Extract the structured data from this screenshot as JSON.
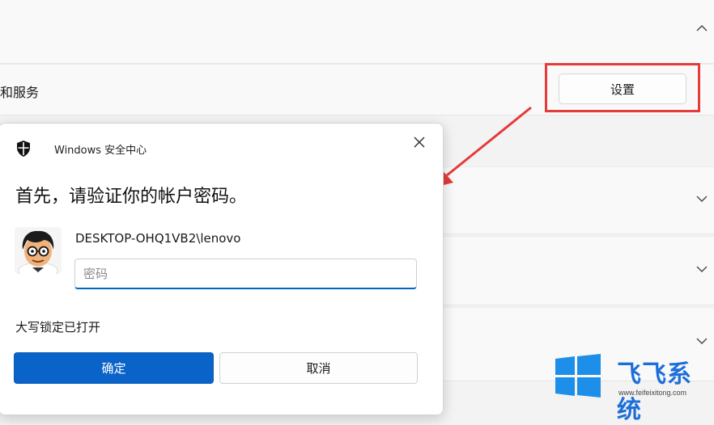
{
  "settings_page": {
    "row_label": "和服务",
    "settings_button_label": "设置"
  },
  "dialog": {
    "app_title": "Windows 安全中心",
    "heading": "首先，请验证你的帐户密码。",
    "account_name": "DESKTOP-OHQ1VB2\\lenovo",
    "password_placeholder": "密码",
    "password_value": "",
    "capslock_notice": "大写锁定已打开",
    "ok_label": "确定",
    "cancel_label": "取消"
  },
  "watermark": {
    "title": "飞飞系统",
    "url": "www.feifeixitong.com"
  },
  "icons": {
    "chevron_up": "chevron-up-icon",
    "chevron_down": "chevron-down-icon",
    "shield": "shield-icon",
    "close": "close-icon",
    "windows_logo": "windows-logo-icon"
  },
  "colors": {
    "accent": "#0a63c8",
    "highlight": "#e43b3b",
    "watermark_blue": "#1d6fd8"
  }
}
